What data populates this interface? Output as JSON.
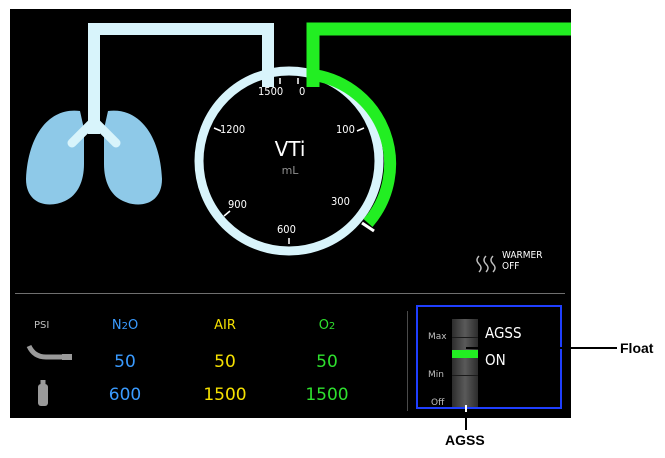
{
  "vti": {
    "title": "VTi",
    "unit": "mL",
    "scale": [
      "1500",
      "0",
      "1200",
      "100",
      "900",
      "300",
      "600"
    ]
  },
  "warmer": {
    "line1": "WARMER",
    "line2": "OFF"
  },
  "gas": {
    "unit_label": "PSI",
    "columns": [
      {
        "name": "N2O",
        "pipeline": "50",
        "cylinder": "600",
        "color": "#3a9bff"
      },
      {
        "name": "AIR",
        "pipeline": "50",
        "cylinder": "1500",
        "color": "#f5e000"
      },
      {
        "name": "O2",
        "pipeline": "50",
        "cylinder": "1500",
        "color": "#2ee02e"
      }
    ]
  },
  "agss": {
    "title": "AGSS",
    "status": "ON",
    "level_labels": {
      "max": "Max",
      "min": "Min",
      "off": "Off"
    }
  },
  "callouts": {
    "float": "Float",
    "agss": "AGSS"
  },
  "colors": {
    "lung": "#8ec9e8",
    "circuit": "#d8f4fb",
    "flow": "#22ee22",
    "panel_border": "#1f3fff"
  }
}
